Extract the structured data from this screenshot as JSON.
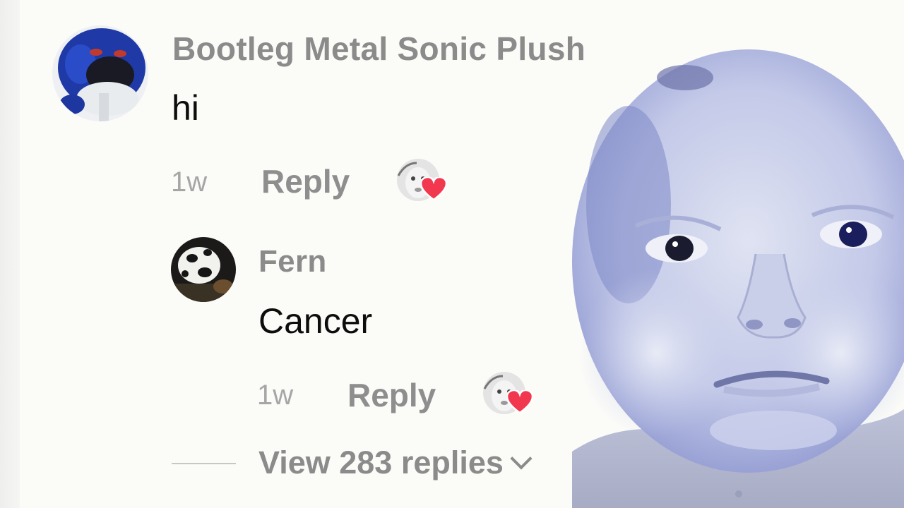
{
  "comments": [
    {
      "username": "Bootleg Metal Sonic Plush",
      "text": "hi",
      "time": "1w",
      "reply_label": "Reply"
    },
    {
      "username": "Fern",
      "text": "Cancer",
      "time": "1w",
      "reply_label": "Reply"
    }
  ],
  "view_replies_label": "View 283 replies",
  "icons": {
    "like": "heart-icon",
    "expand": "chevron-down-icon"
  },
  "colors": {
    "username": "#8b8b8b",
    "body_text": "#0d0d0d",
    "heart": "#f2384f",
    "meme_tint": "#b8c0f0"
  }
}
